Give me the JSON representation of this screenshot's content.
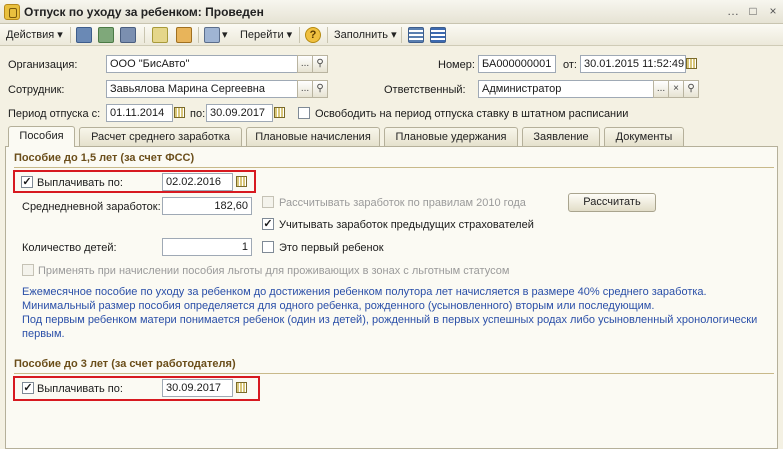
{
  "window": {
    "title": "Отпуск по уходу за ребенком: Проведен",
    "controls": [
      "…",
      "□",
      "×"
    ]
  },
  "toolbar": {
    "actions_label": "Действия",
    "goto_label": "Перейти",
    "fill_label": "Заполнить",
    "help_icon": "?"
  },
  "header": {
    "organization_label": "Организация:",
    "organization_value": "ООО \"БисАвто\"",
    "number_label": "Номер:",
    "number_value": "БА000000001",
    "date_label": "от:",
    "date_value": "30.01.2015 11:52:49",
    "employee_label": "Сотрудник:",
    "employee_value": "Завьялова Марина Сергеевна",
    "responsible_label": "Ответственный:",
    "responsible_value": "Администратор",
    "period_label": "Период отпуска с:",
    "period_from": "01.11.2014",
    "period_to_label": "по:",
    "period_to": "30.09.2017",
    "free_rate_label": "Освободить на период отпуска ставку в штатном расписании",
    "select_btn": "...",
    "clear_btn": "×"
  },
  "tabs": [
    {
      "label": "Пособия"
    },
    {
      "label": "Расчет среднего заработка"
    },
    {
      "label": "Плановые начисления"
    },
    {
      "label": "Плановые удержания"
    },
    {
      "label": "Заявление"
    },
    {
      "label": "Документы"
    }
  ],
  "benefit_15": {
    "title": "Пособие до 1,5 лет (за счет ФСС)",
    "pay_until_label": "Выплачивать по:",
    "pay_until_value": "02.02.2016",
    "pay_checked": "✓",
    "calc_2010_label": "Рассчитывать заработок по правилам 2010 года",
    "calc_button": "Рассчитать",
    "avg_earnings_label": "Среднедневной заработок:",
    "avg_earnings_value": "182,60",
    "prev_employers_label": "Учитывать заработок предыдущих страхователей",
    "prev_employers_checked": "✓",
    "children_label": "Количество детей:",
    "children_value": "1",
    "first_child_label": "Это первый ребенок",
    "benefits_zone_label": "Применять при начислении пособия льготы для проживающих в зонах с льготным статусом",
    "info_line1": "Ежемесячное пособие по уходу за ребенком до достижения ребенком полутора лет начисляется в размере 40% среднего заработка.",
    "info_line2": "Минимальный размер пособия определяется для одного ребенка, рожденного (усыновленного) вторым или последующим.",
    "info_line3": "Под первым ребенком матери понимается ребенок (один из детей), рожденный в первых успешных родах либо усыновленный хронологически",
    "info_line4": "первым."
  },
  "benefit_3": {
    "title": "Пособие до 3 лет (за счет работодателя)",
    "pay_until_label": "Выплачивать по:",
    "pay_until_value": "30.09.2017",
    "pay_checked": "✓"
  },
  "colors": {
    "highlight": "#d71920",
    "section_title": "#6b4e1a",
    "info_text": "#2a4fa8"
  }
}
